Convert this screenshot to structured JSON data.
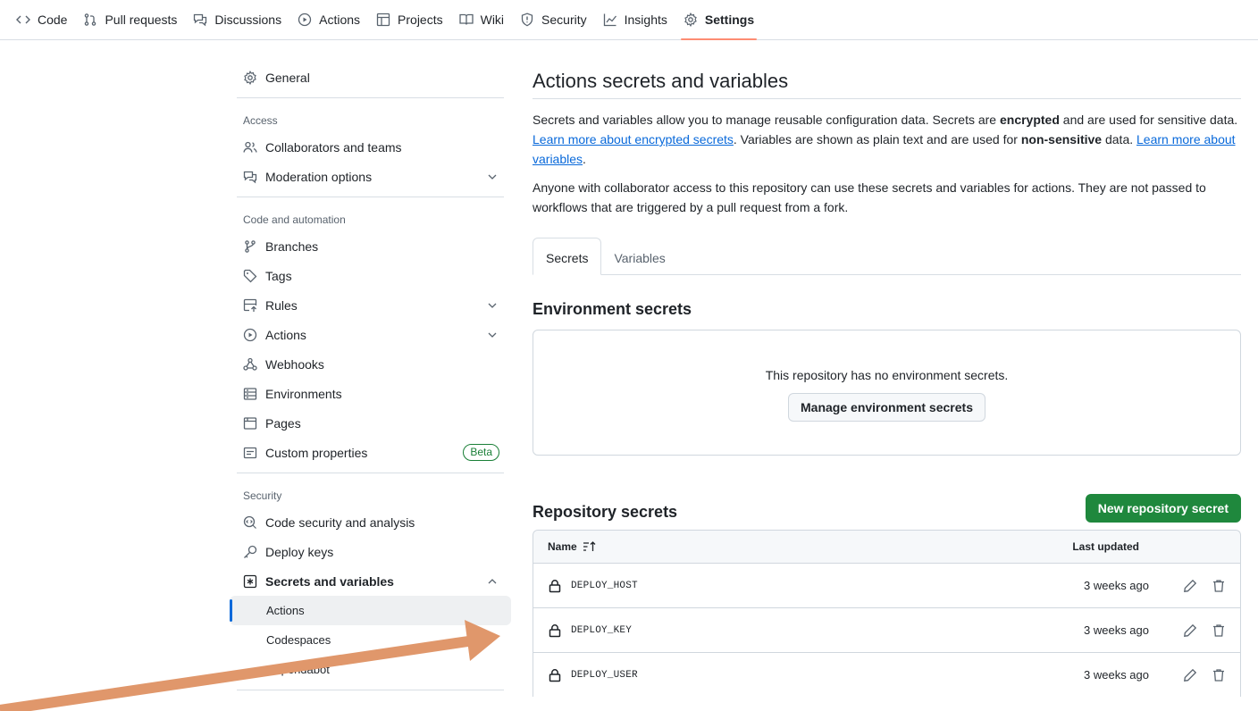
{
  "repo_nav": {
    "tabs": [
      {
        "label": "Code",
        "icon": "code-icon"
      },
      {
        "label": "Pull requests",
        "icon": "git-pull-request-icon"
      },
      {
        "label": "Discussions",
        "icon": "comment-discussion-icon"
      },
      {
        "label": "Actions",
        "icon": "play-icon"
      },
      {
        "label": "Projects",
        "icon": "table-icon"
      },
      {
        "label": "Wiki",
        "icon": "book-icon"
      },
      {
        "label": "Security",
        "icon": "shield-icon"
      },
      {
        "label": "Insights",
        "icon": "graph-icon"
      },
      {
        "label": "Settings",
        "icon": "gear-icon",
        "active": true
      }
    ]
  },
  "sidebar": {
    "general": "General",
    "access_heading": "Access",
    "collaborators": "Collaborators and teams",
    "moderation": "Moderation options",
    "code_heading": "Code and automation",
    "branches": "Branches",
    "tags": "Tags",
    "rules": "Rules",
    "actions": "Actions",
    "webhooks": "Webhooks",
    "environments": "Environments",
    "pages": "Pages",
    "custom_properties": "Custom properties",
    "beta_badge": "Beta",
    "security_heading": "Security",
    "code_security": "Code security and analysis",
    "deploy_keys": "Deploy keys",
    "secrets_variables": "Secrets and variables",
    "sub_actions": "Actions",
    "sub_codespaces": "Codespaces",
    "sub_dependabot": "Dependabot"
  },
  "main": {
    "title": "Actions secrets and variables",
    "p1_a": "Secrets and variables allow you to manage reusable configuration data. Secrets are ",
    "p1_b": "encrypted",
    "p1_c": " and are used for sensitive data. ",
    "p1_link1": "Learn more about encrypted secrets",
    "p1_d": ". Variables are shown as plain text and are used for ",
    "p1_e": "non-sensitive",
    "p1_f": " data. ",
    "p1_link2": "Learn more about variables",
    "p1_g": ".",
    "p2": "Anyone with collaborator access to this repository can use these secrets and variables for actions. They are not passed to workflows that are triggered by a pull request from a fork.",
    "tab_secrets": "Secrets",
    "tab_variables": "Variables",
    "env_heading": "Environment secrets",
    "env_empty": "This repository has no environment secrets.",
    "env_manage_btn": "Manage environment secrets",
    "repo_heading": "Repository secrets",
    "new_secret_btn": "New repository secret",
    "col_name": "Name",
    "col_updated": "Last updated",
    "secrets": [
      {
        "name": "DEPLOY_HOST",
        "updated": "3 weeks ago"
      },
      {
        "name": "DEPLOY_KEY",
        "updated": "3 weeks ago"
      },
      {
        "name": "DEPLOY_USER",
        "updated": "3 weeks ago"
      }
    ]
  },
  "annotation": {
    "color": "#e0976b"
  },
  "colors": {
    "accent": "#0969da",
    "primary_button": "#1f883d",
    "active_tab_underline": "#fd8c73"
  }
}
